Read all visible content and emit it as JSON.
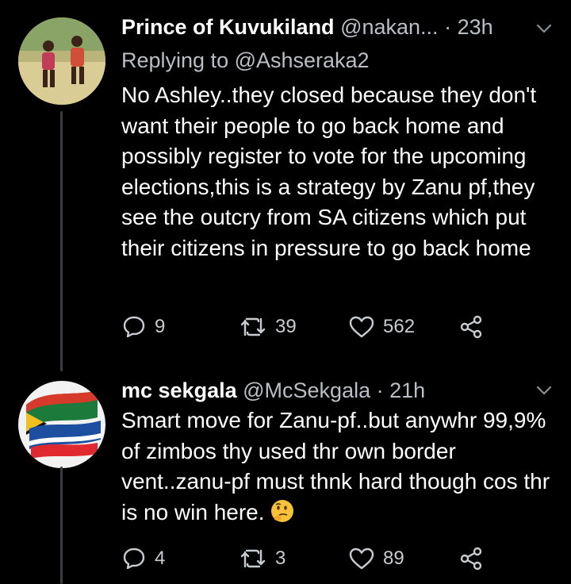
{
  "tweets": [
    {
      "name": "Prince of Kuvukiland",
      "handle": "@nakan...",
      "separator": "·",
      "time": "23h",
      "reply_to": "Replying to @Ashseraka2",
      "text": "No Ashley..they closed because they don't want their people to go back home and possibly register to vote for the upcoming elections,this is a strategy by Zanu pf,they see the outcry from SA citizens which put their citizens in pressure to go back home",
      "counts": {
        "replies": "9",
        "retweets": "39",
        "likes": "562"
      }
    },
    {
      "name": "mc sekgala",
      "handle": "@McSekgala",
      "separator": "·",
      "time": "21h",
      "text": "Smart move for Zanu-pf..but anywhr 99,9% of zimbos thy used thr own border vent..zanu-pf must thnk hard though cos thr is no win here.",
      "emoji": "thinking-face-emoji",
      "counts": {
        "replies": "4",
        "retweets": "3",
        "likes": "89"
      }
    }
  ],
  "colors": {
    "background": "#000000",
    "primary_text": "#ffffff",
    "secondary_text": "#b9bfc5",
    "thread_line": "#3a3d40"
  }
}
